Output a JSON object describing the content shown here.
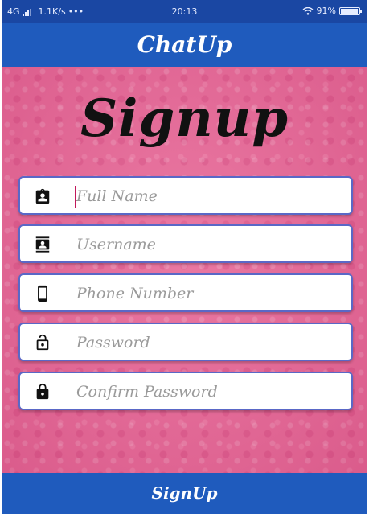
{
  "status_bar": {
    "network": "4G",
    "speed": "1.1K/s",
    "dots": "•••",
    "time": "20:13",
    "battery": "91%"
  },
  "app_bar": {
    "title": "ChatUp"
  },
  "screen": {
    "heading": "Signup"
  },
  "form": {
    "full_name": {
      "placeholder": "Full Name",
      "icon": "contact-badge-icon"
    },
    "username": {
      "placeholder": "Username",
      "icon": "account-box-icon"
    },
    "phone": {
      "placeholder": "Phone Number",
      "icon": "phone-icon"
    },
    "password": {
      "placeholder": "Password",
      "icon": "lock-open-icon"
    },
    "confirm_password": {
      "placeholder": "Confirm Password",
      "icon": "lock-icon"
    }
  },
  "actions": {
    "signup_label": "SignUp"
  },
  "colors": {
    "primary": "#1f5bbd",
    "status_bar": "#1a47a3",
    "background": "#e7709c",
    "field_border": "#5a68c7",
    "cursor": "#c2185b"
  }
}
